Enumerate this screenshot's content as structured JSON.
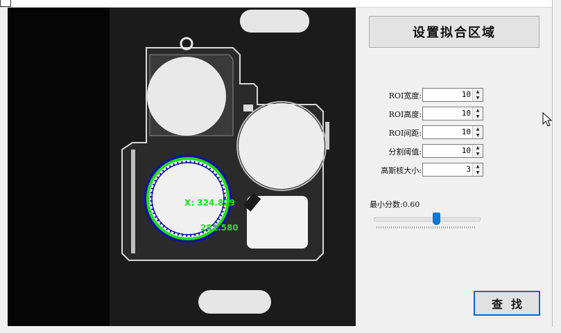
{
  "window": {
    "title": ""
  },
  "viewer": {
    "overlay_x_text": "X: 324.829",
    "overlay_y_text": "281.580",
    "overlay_color": "#22dd22",
    "fit_circle_color": "#1010b0"
  },
  "panel": {
    "header_label": "设置拟合区域",
    "params": [
      {
        "label": "ROI宽度:",
        "value": "10"
      },
      {
        "label": "ROI高度:",
        "value": "10"
      },
      {
        "label": "ROI间距:",
        "value": "10"
      },
      {
        "label": "分割阈值:",
        "value": "10"
      },
      {
        "label": "高斯核大小:",
        "value": "3"
      }
    ],
    "min_score_label": "最小分数:0.60",
    "min_score_value": 0.6,
    "find_label": "查找"
  },
  "colors": {
    "accent": "#0a78d7",
    "panel_bg": "#f0f0f0"
  },
  "icons": {
    "spin_up": "▲",
    "spin_down": "▼",
    "cursor": "arrow-cursor-icon"
  }
}
